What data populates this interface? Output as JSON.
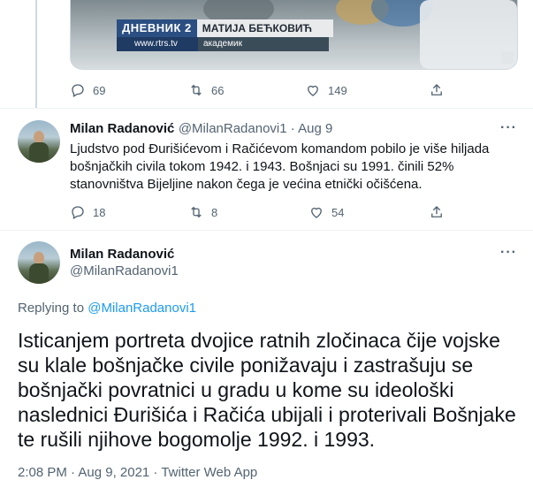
{
  "top_tweet": {
    "banner_channel": "ДНЕВНИК 2",
    "banner_name": "МАТИЈА БЕЋКОВИЋ",
    "banner_site": "www.rtrs.tv",
    "banner_role": "академик",
    "replies": "69",
    "retweets": "66",
    "likes": "149"
  },
  "reply_tweet": {
    "name": "Milan Radanović",
    "handle_date": "@MilanRadanovi1 · Aug 9",
    "text_line1": "Ljudstvo pod Đurišićevom i Račićevom komandom pobilo je više hiljada",
    "text_line2": "bošnjačkih civila tokom 1942. i 1943. Bošnjaci su 1991. činili 52%",
    "text_line3": "stanovništva Bijeljine nakon čega je većina etnički očišćena.",
    "replies": "18",
    "retweets": "8",
    "likes": "54",
    "more": "···"
  },
  "main_tweet": {
    "name": "Milan Radanović",
    "handle": "@MilanRadanovi1",
    "more": "···",
    "replying_to_label": "Replying to",
    "replying_to_handle": "@MilanRadanovi1",
    "text_line1": "Isticanjem portreta dvojice ratnih zločinaca čije vojske",
    "text_line2": "su klale bošnjačke civile ponižavaju i zastrašuju se",
    "text_line3": "bošnjački povratnici u gradu u kome su ideološki",
    "text_line4": "naslednici Đurišića i Račića ubijali i proterivali Bošnjake",
    "text_line5": "te rušili njihove bogomolje 1992. i 1993.",
    "timestamp": "2:08 PM · Aug 9, 2021 · Twitter Web App"
  },
  "colors": {
    "accent": "#1d9bf0",
    "muted": "#536471",
    "divider": "#eff3f4"
  },
  "icons": [
    "reply-icon",
    "retweet-icon",
    "like-icon",
    "share-icon",
    "more-icon"
  ]
}
